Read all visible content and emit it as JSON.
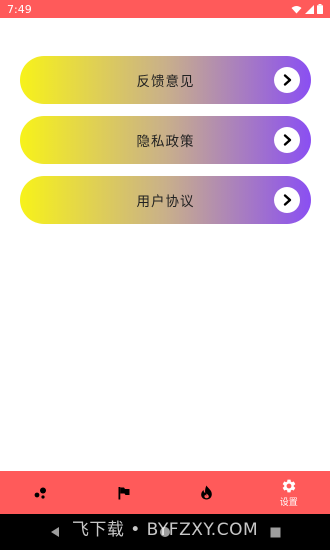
{
  "status_bar": {
    "time": "7:49"
  },
  "menu": {
    "items": [
      {
        "label": "反馈意见"
      },
      {
        "label": "隐私政策"
      },
      {
        "label": "用户协议"
      }
    ]
  },
  "tabbar": {
    "active_tab": "设置",
    "tabs": [
      {
        "icon": "bubbles-icon",
        "label": ""
      },
      {
        "icon": "flag-icon",
        "label": ""
      },
      {
        "icon": "fire-icon",
        "label": ""
      },
      {
        "icon": "gear-icon",
        "label": "设置"
      }
    ]
  },
  "watermark": {
    "text": "飞下载 • BYFZXY.COM"
  },
  "colors": {
    "accent": "#ff5a5a",
    "gradient_start": "#f7f21a",
    "gradient_end": "#8a4ff2"
  }
}
